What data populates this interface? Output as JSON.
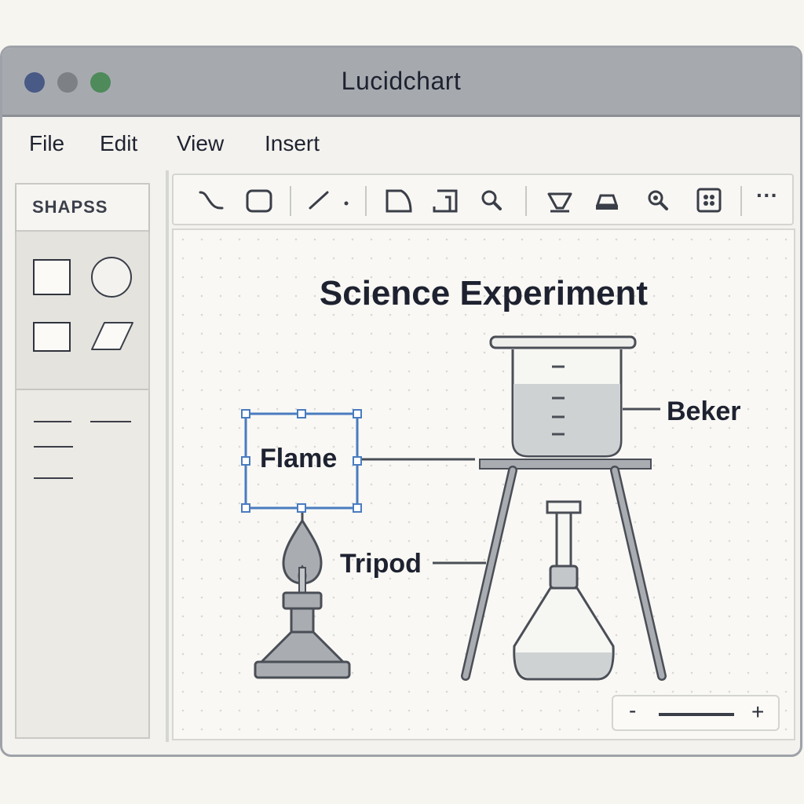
{
  "window": {
    "title": "Lucidchart"
  },
  "menu": [
    "File",
    "Edit",
    "View",
    "Insert"
  ],
  "sidebar": {
    "title": "SHAPSS"
  },
  "toolbar": {
    "tools": [
      "curve-connector",
      "rounded-rect",
      "line",
      "point",
      "shape-d",
      "frame",
      "search",
      "funnel",
      "stamp",
      "zoom",
      "grid",
      "more"
    ],
    "more_label": "···"
  },
  "diagram": {
    "title": "Science Experiment",
    "labels": {
      "flame": "Flame",
      "beaker": "Beker",
      "tripod": "Tripod"
    },
    "selected": "Flame"
  },
  "zoom": {
    "minus": "-",
    "plus": "+"
  },
  "colors": {
    "selection": "#4a7cc0",
    "stroke": "#4a4e56",
    "fill": "#a9adb2",
    "liquid": "#cfd2d3"
  }
}
